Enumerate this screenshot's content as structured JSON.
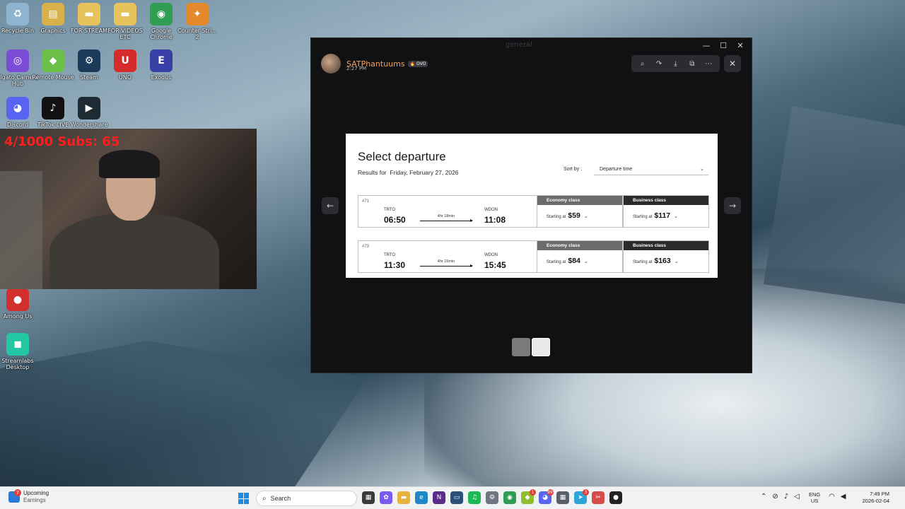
{
  "desktop": {
    "icons": [
      {
        "label": "Recycle Bin",
        "color": "#8fb4cf",
        "glyph": "♻"
      },
      {
        "label": "Graphics",
        "color": "#d8b14a",
        "glyph": "▤"
      },
      {
        "label": "FOR STREAM",
        "color": "#e8c35b",
        "glyph": "▬"
      },
      {
        "label": "FOR VIDEOS ETC",
        "color": "#e8c35b",
        "glyph": "▬"
      },
      {
        "label": "Google Chrome",
        "color": "#2f9e53",
        "glyph": "◉"
      },
      {
        "label": "Counter Stri... 2",
        "color": "#e38a2c",
        "glyph": "✦"
      },
      {
        "label": "Elgato Camera Hub",
        "color": "#7b4dd6",
        "glyph": "◎"
      },
      {
        "label": "Remote Mouse",
        "color": "#6cc04a",
        "glyph": "◆"
      },
      {
        "label": "Steam",
        "color": "#1c3b5a",
        "glyph": "⚙"
      },
      {
        "label": "UNO",
        "color": "#d62b2b",
        "glyph": "U"
      },
      {
        "label": "Exodus",
        "color": "#3a3fa8",
        "glyph": "E"
      },
      {
        "label": "Discord",
        "color": "#5865f2",
        "glyph": "◕"
      },
      {
        "label": "TikTok LIVE",
        "color": "#111111",
        "glyph": "♪"
      },
      {
        "label": "Wondershare",
        "color": "#1f2b33",
        "glyph": "▶"
      },
      {
        "label": "Among Us",
        "color": "#d32f2f",
        "glyph": "●"
      },
      {
        "label": "Streamlabs Desktop",
        "color": "#23c7a4",
        "glyph": "◼"
      }
    ]
  },
  "webcam": {
    "goal_text": "4/1000  Subs: 65"
  },
  "viewer": {
    "author_name": "SATPhantuums",
    "author_tag": "🔥 OVO",
    "timestamp": "2:27 PM",
    "toolbar_icons": [
      "zoom-icon",
      "forward-icon",
      "download-icon",
      "open-external-icon",
      "more-icon"
    ],
    "window_controls": {
      "minimize": "—",
      "maximize": "☐",
      "close": "✕"
    }
  },
  "flight": {
    "title": "Select departure",
    "results_for_label": "Results for",
    "results_date": "Friday, February 27, 2026",
    "sort_label": "Sort by :",
    "sort_value": "Departure time",
    "rows": [
      {
        "flight_no": "#71",
        "from_code": "TRTO",
        "to_code": "WDON",
        "depart": "06:50",
        "arrive": "11:08",
        "duration": "4hr 18min",
        "economy_label": "Economy class",
        "economy_prefix": "Starting at",
        "economy_price": "$59",
        "business_label": "Business class",
        "business_prefix": "Starting at",
        "business_price": "$117"
      },
      {
        "flight_no": "#73",
        "from_code": "TRTO",
        "to_code": "WDON",
        "depart": "11:30",
        "arrive": "15:45",
        "duration": "4hr 15min",
        "economy_label": "Economy class",
        "economy_prefix": "Starting at",
        "economy_price": "$84",
        "business_label": "Business class",
        "business_prefix": "Starting at",
        "business_price": "$163"
      }
    ],
    "colors": {
      "economy": "#6b6b6b",
      "business": "#2b2b2b"
    }
  },
  "taskbar": {
    "widget_badge": "7",
    "widget_title": "Upcoming",
    "widget_subtitle": "Earnings",
    "search_placeholder": "Search",
    "lang_line1": "ENG",
    "lang_line2": "US",
    "time": "7:49 PM",
    "date": "2026-02-04",
    "badges": {
      "app_9": "1",
      "app_10": "99+",
      "app_14": "3"
    }
  }
}
